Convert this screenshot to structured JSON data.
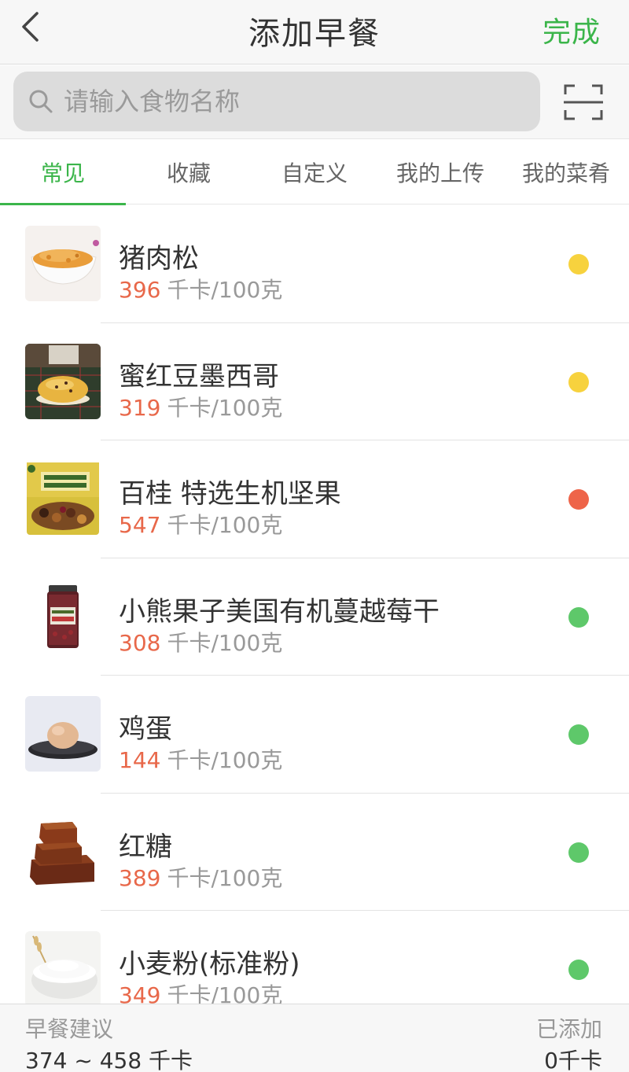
{
  "header": {
    "title": "添加早餐",
    "done_label": "完成"
  },
  "search": {
    "placeholder": "请输入食物名称"
  },
  "tabs": [
    {
      "label": "常见",
      "active": true
    },
    {
      "label": "收藏",
      "active": false
    },
    {
      "label": "自定义",
      "active": false
    },
    {
      "label": "我的上传",
      "active": false
    },
    {
      "label": "我的菜肴",
      "active": false
    }
  ],
  "foods": [
    {
      "name": "猪肉松",
      "kcal": "396",
      "unit": "千卡/100克",
      "level_color": "#f7d23e",
      "icon": "pork-floss-thumbnail"
    },
    {
      "name": "蜜红豆墨西哥",
      "kcal": "319",
      "unit": "千卡/100克",
      "level_color": "#f7d23e",
      "icon": "red-bean-bun-thumbnail"
    },
    {
      "name": "百桂 特选生机坚果",
      "kcal": "547",
      "unit": "千卡/100克",
      "level_color": "#ee6449",
      "icon": "mixed-nuts-thumbnail"
    },
    {
      "name": "小熊果子美国有机蔓越莓干",
      "kcal": "308",
      "unit": "千卡/100克",
      "level_color": "#5ec86a",
      "icon": "cranberry-jar-thumbnail"
    },
    {
      "name": "鸡蛋",
      "kcal": "144",
      "unit": "千卡/100克",
      "level_color": "#5ec86a",
      "icon": "egg-thumbnail"
    },
    {
      "name": "红糖",
      "kcal": "389",
      "unit": "千卡/100克",
      "level_color": "#5ec86a",
      "icon": "brown-sugar-thumbnail"
    },
    {
      "name": "小麦粉(标准粉)",
      "kcal": "349",
      "unit": "千卡/100克",
      "level_color": "#5ec86a",
      "icon": "wheat-flour-thumbnail"
    }
  ],
  "footer": {
    "suggestion_label": "早餐建议",
    "suggestion_value": "374 ~ 458 千卡",
    "added_label": "已添加",
    "added_value": "0千卡"
  },
  "colors": {
    "accent": "#3bb54a",
    "kcal_number": "#e8684a"
  }
}
